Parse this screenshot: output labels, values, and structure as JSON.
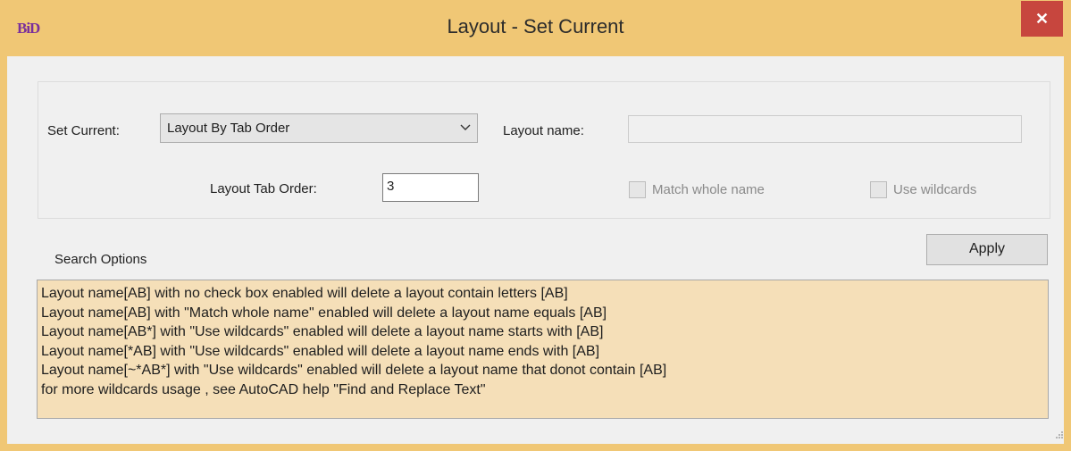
{
  "window": {
    "app_icon_text": "BiD",
    "title": "Layout - Set Current",
    "close_label": "✕"
  },
  "form": {
    "set_current_label": "Set Current:",
    "set_current_value": "Layout By Tab Order",
    "layout_name_label": "Layout name:",
    "layout_name_value": "",
    "layout_tab_order_label": "Layout Tab Order:",
    "layout_tab_order_value": "3",
    "match_whole_name_label": "Match whole name",
    "match_whole_name_checked": false,
    "use_wildcards_label": "Use wildcards",
    "use_wildcards_checked": false
  },
  "search_options_label": "Search Options",
  "apply_label": "Apply",
  "info_lines": [
    "Layout name[AB] with no check box enabled will delete a layout contain letters [AB]",
    "Layout name[AB] with \"Match whole name\" enabled will delete a layout name equals [AB]",
    "Layout name[AB*] with \"Use wildcards\" enabled will delete a layout name starts with [AB]",
    "Layout name[*AB] with \"Use wildcards\" enabled will delete a layout name ends with [AB]",
    "Layout name[~*AB*] with \"Use wildcards\" enabled will delete a layout name that donot contain [AB]",
    "for more wildcards usage , see AutoCAD help  \"Find and Replace Text\""
  ],
  "colors": {
    "title_bar": "#f0c775",
    "close_button": "#c7463e",
    "info_background": "#f5dfb8"
  }
}
